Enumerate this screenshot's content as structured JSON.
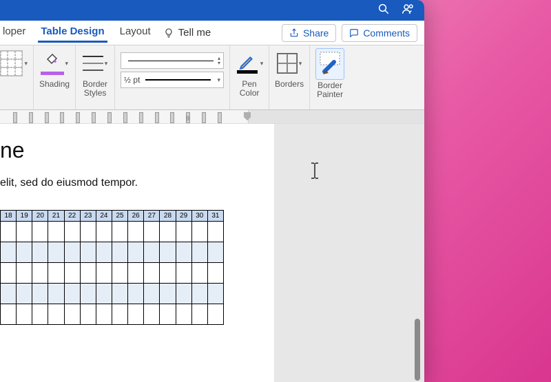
{
  "titlebar": {
    "search_icon": "search",
    "presence_icon": "presence"
  },
  "tabs": {
    "developer": "loper",
    "table_design": "Table Design",
    "layout": "Layout",
    "tell_me": "Tell me"
  },
  "actions": {
    "share": "Share",
    "comments": "Comments"
  },
  "ribbon": {
    "shading": "Shading",
    "border_styles": "Border\nStyles",
    "line_width": "½ pt",
    "pen_color": "Pen\nColor",
    "borders": "Borders",
    "border_painter": "Border\nPainter"
  },
  "ruler": {
    "label": "9"
  },
  "document": {
    "title_fragment": "ne",
    "body_fragment": "elit, sed do eiusmod tempor.",
    "table_headers": [
      "18",
      "19",
      "20",
      "21",
      "22",
      "23",
      "24",
      "25",
      "26",
      "27",
      "28",
      "29",
      "30",
      "31"
    ],
    "rows": 5
  }
}
